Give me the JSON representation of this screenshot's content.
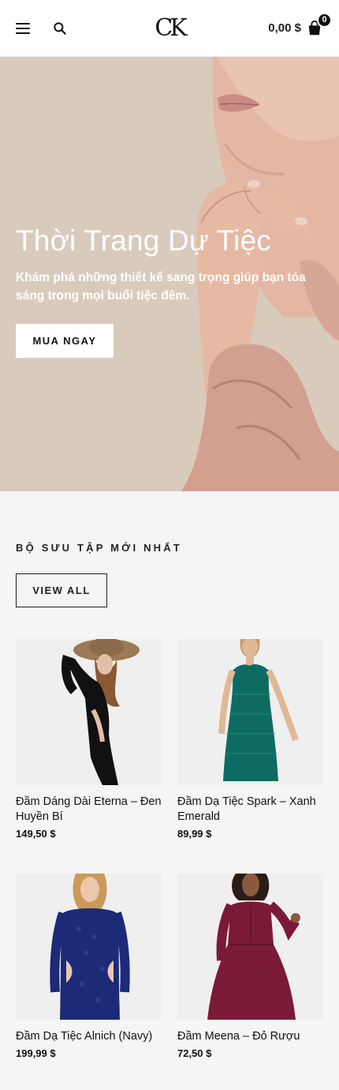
{
  "header": {
    "logo_text": "CK",
    "cart_total": "0,00 $",
    "cart_count": "0",
    "icons": [
      "menu-icon",
      "search-icon",
      "cart-icon"
    ]
  },
  "hero": {
    "title": "Thời Trang Dự Tiệc",
    "subtitle": "Khám phá những thiết kế sang trọng giúp bạn tỏa sáng trong mọi buổi tiệc đêm.",
    "cta_label": "MUA NGAY"
  },
  "collection": {
    "title": "BỘ SƯU TẬP MỚI NHẤT",
    "view_all_label": "VIEW ALL",
    "products": [
      {
        "name": "Đầm Dáng Dài Eterna – Đen Huyền Bí",
        "price": "149,50 $",
        "color": "#111111"
      },
      {
        "name": "Đầm Dạ Tiệc Spark – Xanh Emerald",
        "price": "89,99 $",
        "color": "#0e6b62"
      },
      {
        "name": "Đầm Dạ Tiệc Alnich (Navy)",
        "price": "199,99 $",
        "color": "#1c2a78"
      },
      {
        "name": "Đầm Meena – Đỏ Rượu",
        "price": "72,50 $",
        "color": "#7a1a36"
      }
    ]
  },
  "colors": {
    "hero_bg": "#d9cbbb",
    "skin": "#e6b9a3",
    "page_bg": "#f5f5f5",
    "accent": "#111111"
  }
}
